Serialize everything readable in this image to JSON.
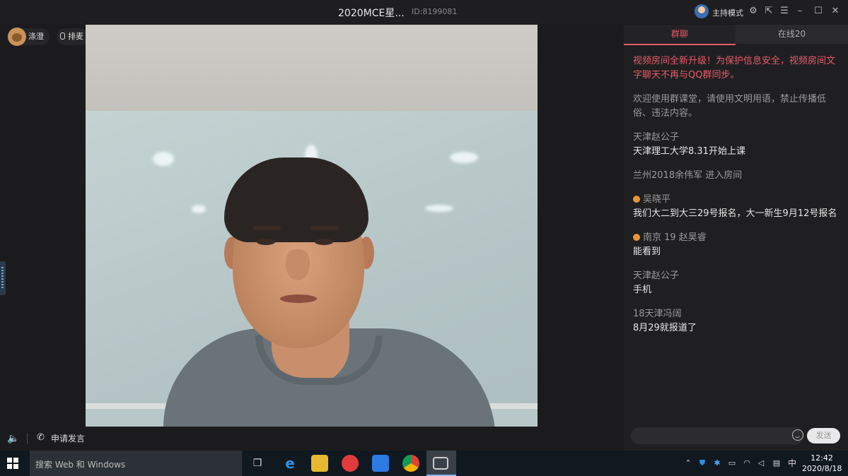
{
  "window": {
    "title": "2020MCE星...",
    "room_id": "ID:8199081",
    "host_mode_label": "主持模式"
  },
  "left": {
    "user_name": "涤澄",
    "queue_label": "排麦",
    "apply_speak_label": "申请发言"
  },
  "chat": {
    "tabs": [
      {
        "label": "群聊",
        "active": true
      },
      {
        "label": "在线20",
        "active": false
      }
    ],
    "notice": "视频房间全新升级！为保护信息安全，视频房间文字聊天不再与QQ群同步。",
    "rules": "欢迎使用群课堂，请使用文明用语，禁止传播低俗、违法内容。",
    "messages": [
      {
        "sender": "天津赵公子",
        "text": "天津理工大学8.31开始上课",
        "badge": false
      },
      {
        "join": "兰州2018余伟军 进入房间"
      },
      {
        "sender": "吴晓平",
        "text": "我们大二到大三29号报名，大一新生9月12号报名",
        "badge": true
      },
      {
        "sender": "南京 19 赵昊睿",
        "text": "能看到",
        "badge": true
      },
      {
        "sender": "天津赵公子",
        "text": "手机",
        "badge": false
      },
      {
        "sender": "18天津冯阔",
        "text": "8月29就报道了",
        "badge": false
      }
    ],
    "input_placeholder": "",
    "send_label": "发送"
  },
  "taskbar": {
    "search_placeholder": "搜索 Web 和 Windows",
    "ime": "中",
    "time": "12:42",
    "date": "2020/8/18"
  },
  "colors": {
    "accent": "#e85a6a",
    "background": "#1b1b1d",
    "taskbar": "#101820"
  }
}
